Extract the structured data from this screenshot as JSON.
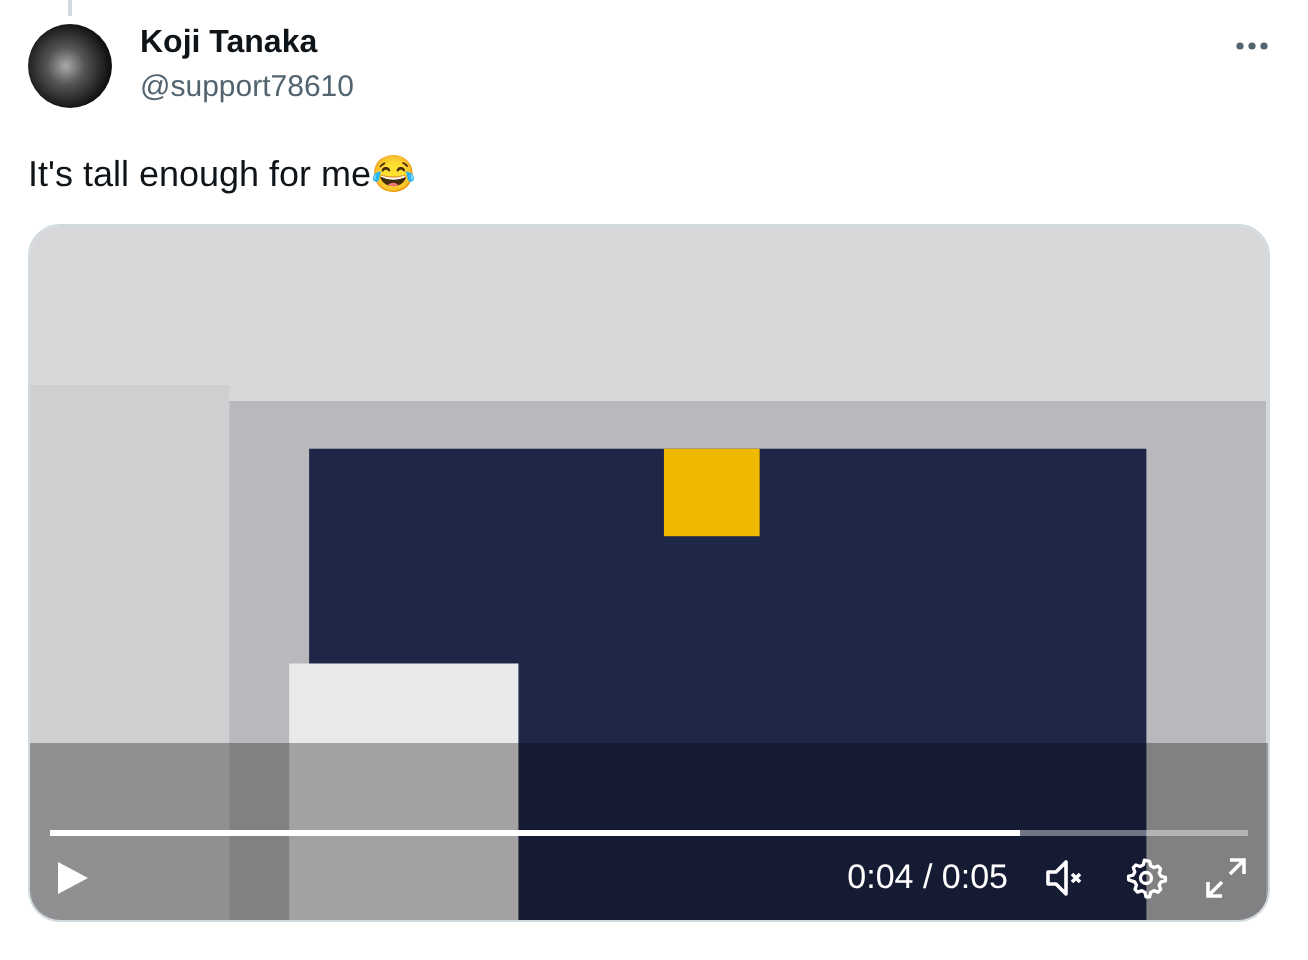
{
  "author": {
    "name": "Koji Tanaka",
    "handle": "@support78610"
  },
  "tweet": {
    "text": "It's tall enough for me😂"
  },
  "video": {
    "progress": {
      "level": 0.81
    },
    "playing": false,
    "muted": true,
    "time": "0:04 / 0:05"
  }
}
